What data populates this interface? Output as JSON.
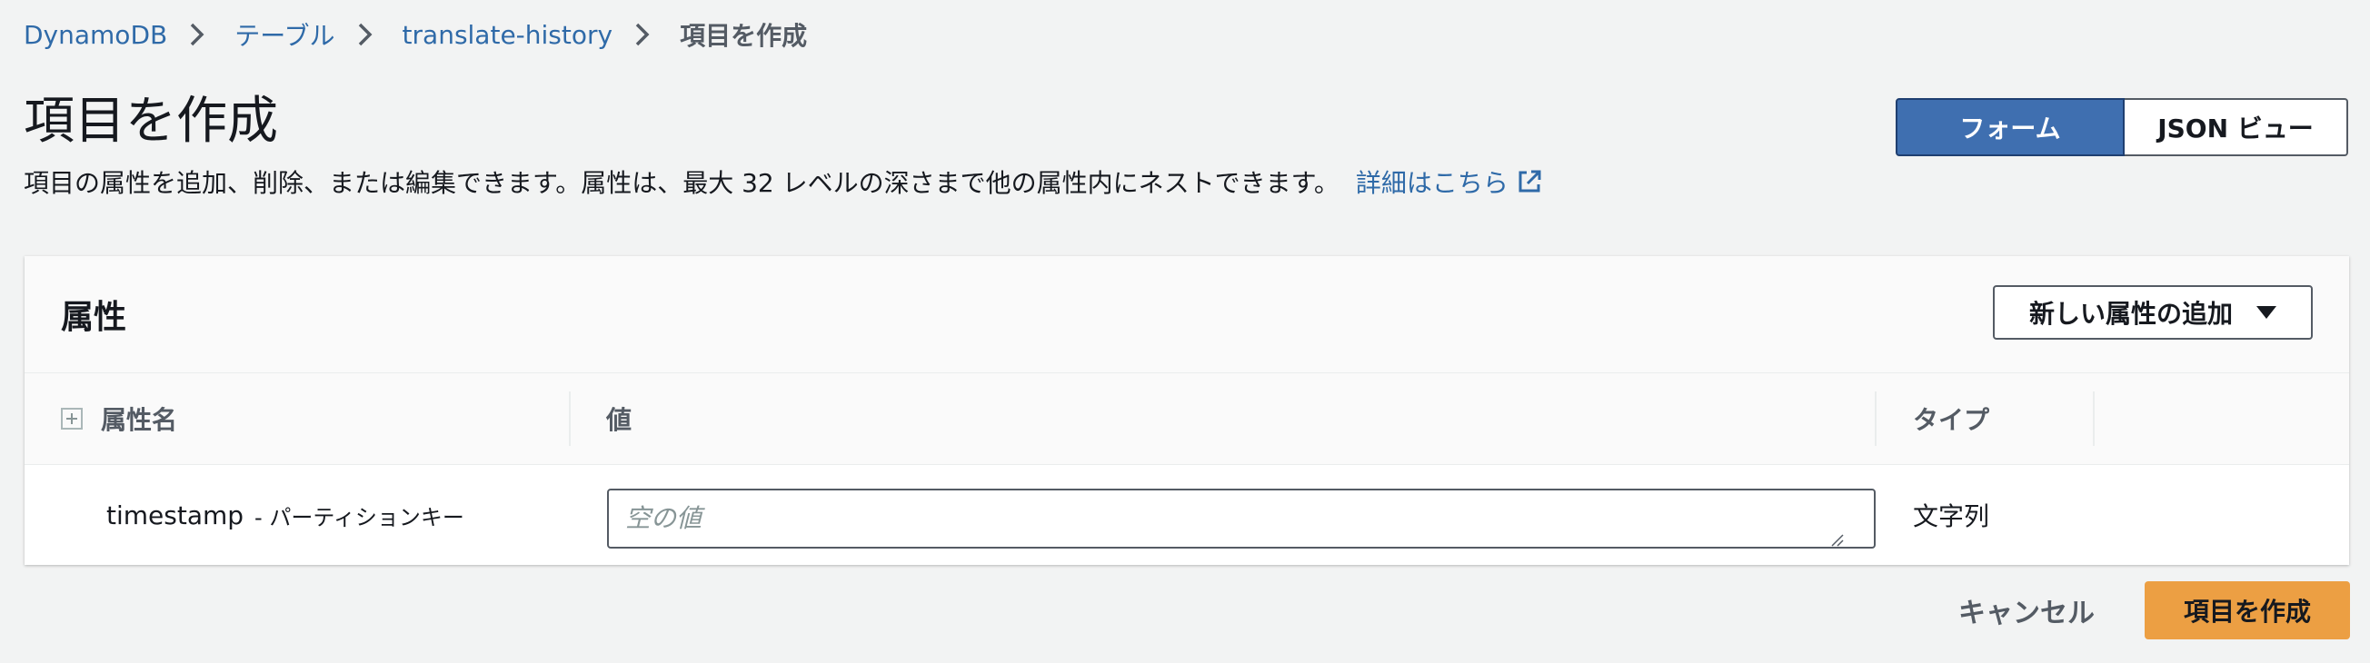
{
  "breadcrumb": {
    "items": [
      "DynamoDB",
      "テーブル",
      "translate-history"
    ],
    "current": "項目を作成"
  },
  "header": {
    "title": "項目を作成",
    "description": "項目の属性を追加、削除、または編集できます。属性は、最大 32 レベルの深さまで他の属性内にネストできます。",
    "learn_more": "詳細はこちら",
    "view_toggle": {
      "form_label": "フォーム",
      "json_label": "JSON ビュー",
      "selected": "フォーム"
    }
  },
  "attributes": {
    "title": "属性",
    "add_button_label": "新しい属性の追加",
    "columns": {
      "name": "属性名",
      "value": "値",
      "type": "タイプ"
    },
    "rows": [
      {
        "name": "timestamp",
        "key_label": "- パーティションキー",
        "value": "",
        "placeholder": "空の値",
        "type": "文字列"
      }
    ]
  },
  "footer": {
    "cancel_label": "キャンセル",
    "create_label": "項目を作成"
  },
  "colors": {
    "link": "#2f6aa8",
    "primary": "#ec9f43",
    "toggle_active": "#3f6fb0"
  }
}
